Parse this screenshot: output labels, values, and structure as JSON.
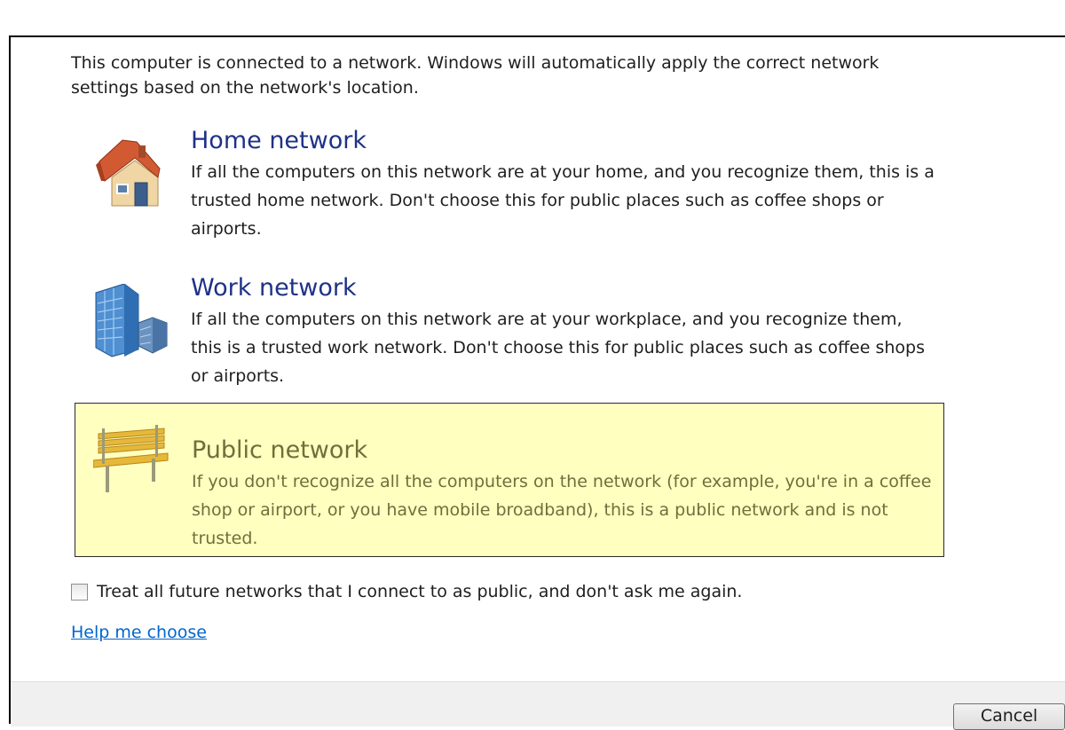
{
  "dialog": {
    "intro": "This computer is connected to a network. Windows will automatically apply the correct network settings based on the network's location."
  },
  "options": [
    {
      "title": "Home network",
      "description": "If all the computers on this network are at your home, and you recognize them, this is a trusted home network.  Don't choose this for public places such as coffee shops or airports.",
      "icon": "house-icon",
      "highlighted": false
    },
    {
      "title": "Work network",
      "description": "If all the computers on this network are at your workplace, and you recognize them, this is a trusted work network.  Don't choose this for public places such as coffee shops or airports.",
      "icon": "office-building-icon",
      "highlighted": false
    },
    {
      "title": "Public network",
      "description": "If you don't recognize all the computers on the network (for example, you're in a coffee shop or airport, or you have mobile broadband), this is a public network and is not trusted.",
      "icon": "park-bench-icon",
      "highlighted": true
    }
  ],
  "checkbox": {
    "label": "Treat all future networks that I connect to as public, and don't ask me again.",
    "checked": false
  },
  "help_link": "Help me choose",
  "footer": {
    "cancel_label": "Cancel"
  },
  "colors": {
    "title_blue": "#1e3287",
    "highlight_bg": "#ffffc0",
    "highlight_text": "#6f6f3c",
    "link": "#0066cc"
  }
}
